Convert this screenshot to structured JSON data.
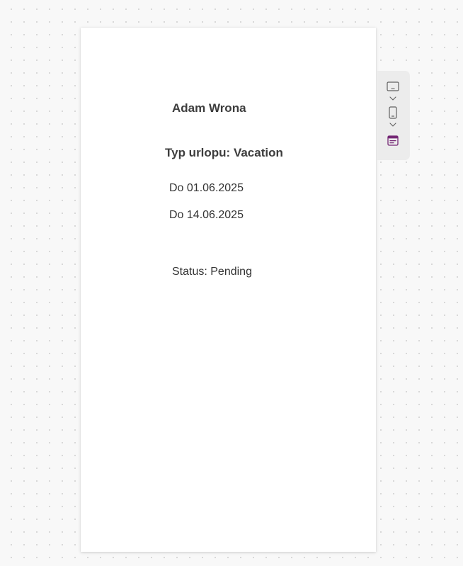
{
  "form": {
    "employee_name": "Adam Wrona",
    "leave_type": "Typ urlopu: Vacation",
    "date_from": "Do 01.06.2025",
    "date_to": "Do 14.06.2025",
    "status": "Status: Pending"
  },
  "toolbar": {
    "items": [
      {
        "icon": "tablet-landscape-icon"
      },
      {
        "icon": "chevron-down-icon"
      },
      {
        "icon": "phone-icon"
      },
      {
        "icon": "chevron-down-icon"
      },
      {
        "icon": "form-layout-icon"
      }
    ],
    "accent_color": "#742774",
    "icon_color": "#616161"
  },
  "colors": {
    "background": "#f8f8f8",
    "canvas": "#ffffff",
    "text": "#333333"
  }
}
